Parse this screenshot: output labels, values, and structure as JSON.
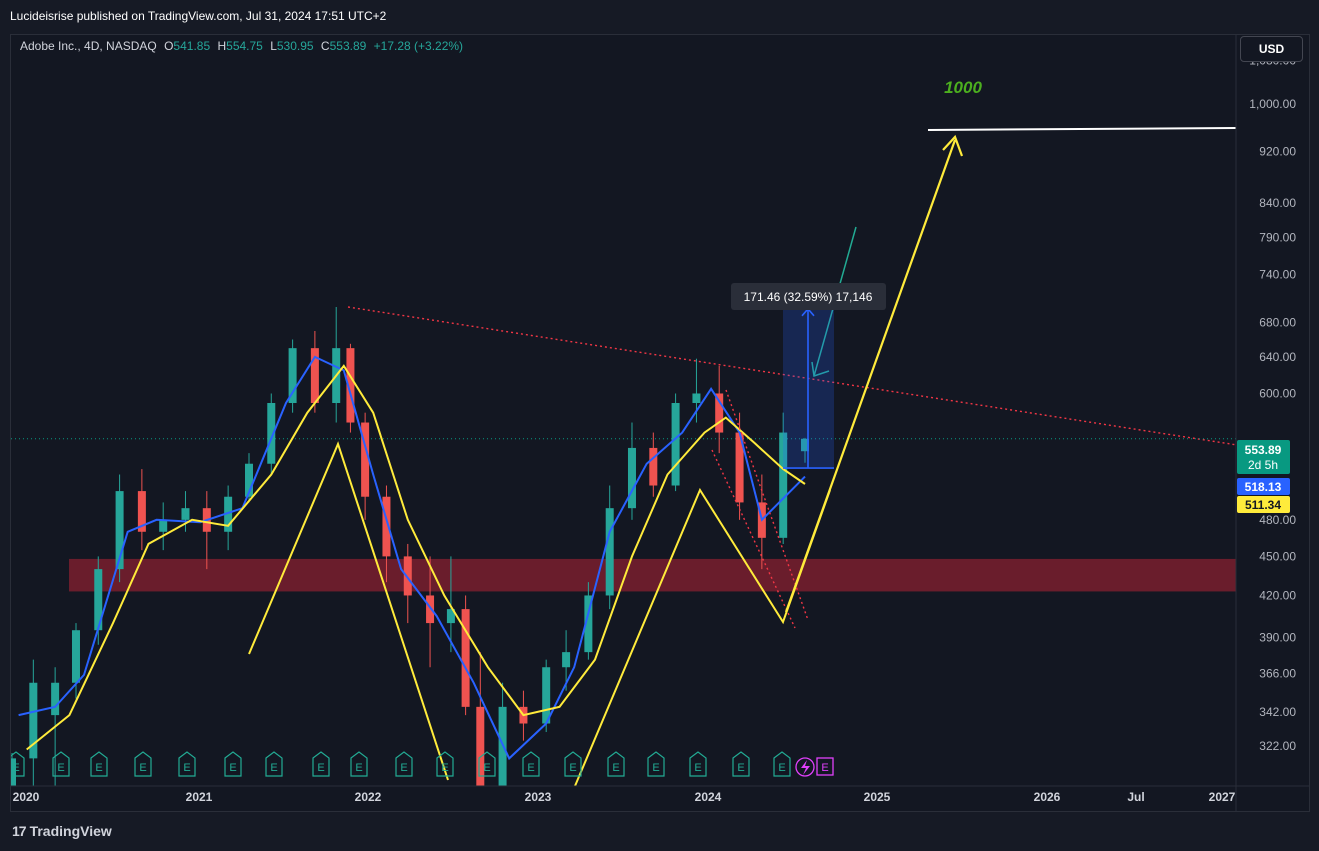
{
  "header": {
    "publisher_line": "Lucideisrise published on TradingView.com, Jul 31, 2024 17:51 UTC+2"
  },
  "legend": {
    "symbol": "Adobe Inc., 4D, NASDAQ",
    "open_label": "O",
    "open": "541.85",
    "high_label": "H",
    "high": "554.75",
    "low_label": "L",
    "low": "530.95",
    "close_label": "C",
    "close": "553.89",
    "change": "+17.28 (+3.22%)"
  },
  "currency_button": "USD",
  "brand": {
    "name": "TradingView",
    "mark": "17"
  },
  "chart_data": {
    "type": "candlestick",
    "symbol": "Adobe Inc.",
    "interval": "4D",
    "exchange": "NASDAQ",
    "y_scale": "log",
    "ylim": [
      300,
      1130
    ],
    "y_ticks": [
      "1,080.00",
      "1,000.00",
      "920.00",
      "840.00",
      "790.00",
      "740.00",
      "680.00",
      "640.00",
      "600.00",
      "480.00",
      "450.00",
      "420.00",
      "390.00",
      "366.00",
      "342.00",
      "322.00"
    ],
    "x_ticks": [
      "2020",
      "2021",
      "2022",
      "2023",
      "2024",
      "2025",
      "2026",
      "Jul",
      "2027"
    ],
    "ohlc": [
      [
        "2020-01-01",
        300,
        318,
        295,
        315
      ],
      [
        "2020-02-15",
        315,
        375,
        285,
        360
      ],
      [
        "2020-04-01",
        340,
        370,
        300,
        360
      ],
      [
        "2020-05-15",
        360,
        400,
        350,
        395
      ],
      [
        "2020-07-01",
        395,
        450,
        385,
        440
      ],
      [
        "2020-08-15",
        440,
        520,
        430,
        505
      ],
      [
        "2020-10-01",
        505,
        525,
        455,
        470
      ],
      [
        "2020-11-15",
        470,
        495,
        455,
        480
      ],
      [
        "2021-01-01",
        480,
        505,
        470,
        490
      ],
      [
        "2021-02-15",
        490,
        505,
        440,
        470
      ],
      [
        "2021-04-01",
        470,
        510,
        455,
        500
      ],
      [
        "2021-05-15",
        500,
        540,
        495,
        530
      ],
      [
        "2021-07-01",
        530,
        600,
        520,
        590
      ],
      [
        "2021-08-15",
        590,
        660,
        580,
        650
      ],
      [
        "2021-10-01",
        650,
        670,
        580,
        590
      ],
      [
        "2021-11-15",
        590,
        699,
        570,
        650
      ],
      [
        "2021-12-15",
        650,
        655,
        560,
        570
      ],
      [
        "2022-01-15",
        570,
        580,
        480,
        500
      ],
      [
        "2022-03-01",
        500,
        510,
        430,
        450
      ],
      [
        "2022-04-15",
        450,
        460,
        400,
        420
      ],
      [
        "2022-06-01",
        420,
        450,
        370,
        400
      ],
      [
        "2022-07-15",
        400,
        450,
        380,
        410
      ],
      [
        "2022-08-15",
        410,
        420,
        340,
        345
      ],
      [
        "2022-09-15",
        345,
        380,
        275,
        300
      ],
      [
        "2022-11-01",
        300,
        360,
        290,
        345
      ],
      [
        "2022-12-15",
        345,
        355,
        325,
        335
      ],
      [
        "2023-02-01",
        335,
        375,
        330,
        370
      ],
      [
        "2023-03-15",
        370,
        395,
        355,
        380
      ],
      [
        "2023-05-01",
        380,
        430,
        375,
        420
      ],
      [
        "2023-06-15",
        420,
        510,
        410,
        490
      ],
      [
        "2023-08-01",
        490,
        570,
        480,
        545
      ],
      [
        "2023-09-15",
        545,
        560,
        500,
        510
      ],
      [
        "2023-11-01",
        510,
        600,
        505,
        590
      ],
      [
        "2023-12-15",
        590,
        638,
        570,
        600
      ],
      [
        "2024-02-01",
        600,
        630,
        540,
        560
      ],
      [
        "2024-03-15",
        560,
        580,
        480,
        495
      ],
      [
        "2024-05-01",
        495,
        520,
        440,
        465
      ],
      [
        "2024-06-15",
        465,
        580,
        460,
        560
      ],
      [
        "2024-07-31",
        541.85,
        554.75,
        530.95,
        553.89
      ]
    ],
    "series": [
      {
        "name": "",
        "color": "#2962ff",
        "points": [
          [
            "2020-01-15",
            340
          ],
          [
            "2020-04-01",
            345
          ],
          [
            "2020-06-01",
            365
          ],
          [
            "2020-09-01",
            470
          ],
          [
            "2020-11-01",
            480
          ],
          [
            "2021-02-01",
            478
          ],
          [
            "2021-05-01",
            490
          ],
          [
            "2021-08-01",
            590
          ],
          [
            "2021-10-01",
            640
          ],
          [
            "2021-12-01",
            625
          ],
          [
            "2022-02-01",
            520
          ],
          [
            "2022-04-01",
            440
          ],
          [
            "2022-06-15",
            405
          ],
          [
            "2022-09-01",
            360
          ],
          [
            "2022-11-15",
            315
          ],
          [
            "2023-02-01",
            335
          ],
          [
            "2023-04-01",
            370
          ],
          [
            "2023-06-15",
            470
          ],
          [
            "2023-09-01",
            530
          ],
          [
            "2023-11-15",
            560
          ],
          [
            "2024-01-15",
            605
          ],
          [
            "2024-03-15",
            560
          ],
          [
            "2024-05-01",
            480
          ],
          [
            "2024-07-31",
            518.13
          ]
        ]
      },
      {
        "name": "",
        "color": "#ffeb3b",
        "points": [
          [
            "2020-02-01",
            320
          ],
          [
            "2020-05-01",
            340
          ],
          [
            "2020-08-01",
            400
          ],
          [
            "2020-10-15",
            460
          ],
          [
            "2021-01-15",
            480
          ],
          [
            "2021-04-01",
            475
          ],
          [
            "2021-07-01",
            520
          ],
          [
            "2021-09-15",
            580
          ],
          [
            "2021-12-01",
            630
          ],
          [
            "2022-02-01",
            580
          ],
          [
            "2022-04-15",
            480
          ],
          [
            "2022-07-01",
            420
          ],
          [
            "2022-10-01",
            370
          ],
          [
            "2022-12-15",
            340
          ],
          [
            "2023-03-01",
            345
          ],
          [
            "2023-05-15",
            375
          ],
          [
            "2023-08-01",
            450
          ],
          [
            "2023-10-15",
            520
          ],
          [
            "2024-01-01",
            560
          ],
          [
            "2024-02-15",
            575
          ],
          [
            "2024-04-15",
            550
          ],
          [
            "2024-06-15",
            525
          ],
          [
            "2024-07-31",
            511.34
          ]
        ]
      }
    ],
    "price_labels": [
      {
        "value": "553.89",
        "sublabel": "2d 5h",
        "color": "#089981"
      },
      {
        "value": "518.13",
        "color": "#2962ff"
      },
      {
        "value": "511.34",
        "color": "#ffeb3b"
      }
    ],
    "annotations": {
      "target_text": "1000",
      "target_level": 1000,
      "measure_label": "171.46 (32.59%) 17,146",
      "measure_from": 526,
      "measure_to": 698,
      "support_zone": [
        423,
        448
      ]
    },
    "earnings_marker": "E",
    "grid": false,
    "legend_position": "top-left"
  }
}
